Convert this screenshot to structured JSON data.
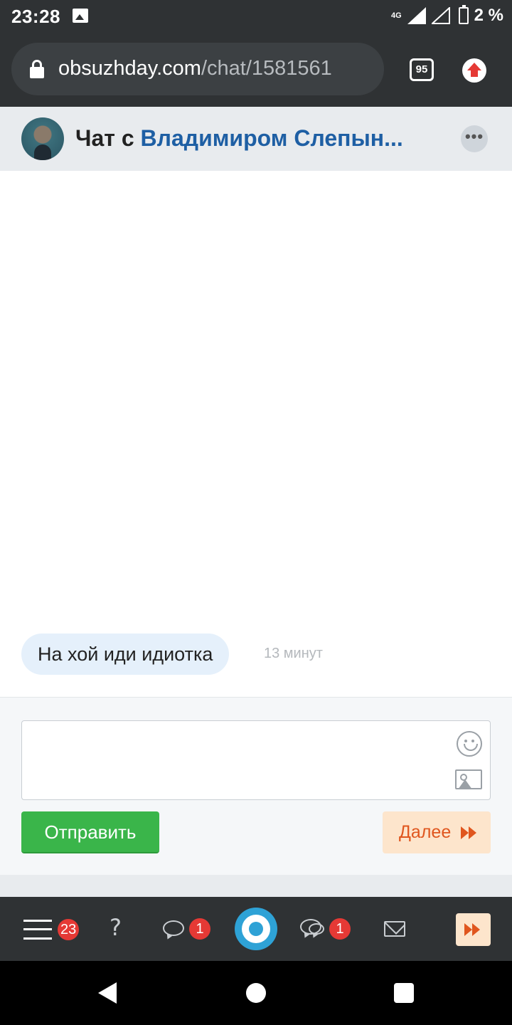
{
  "status_bar": {
    "time": "23:28",
    "network": "4G",
    "battery": "2 %"
  },
  "browser": {
    "url_domain": "obsuzhday.com",
    "url_path": "/chat/1581561",
    "tab_count": "95"
  },
  "chat_header": {
    "prefix": "Чат с ",
    "name": "Владимиром Слепын...",
    "more_label": "•••"
  },
  "messages": [
    {
      "text": "На хой иди идиотка",
      "time": "13 минут"
    }
  ],
  "compose": {
    "send_label": "Отправить",
    "next_label": "Далее"
  },
  "bottom_nav": {
    "menu_badge": "23",
    "question_label": "?",
    "messages_badge": "1",
    "discussions_badge": "1"
  }
}
